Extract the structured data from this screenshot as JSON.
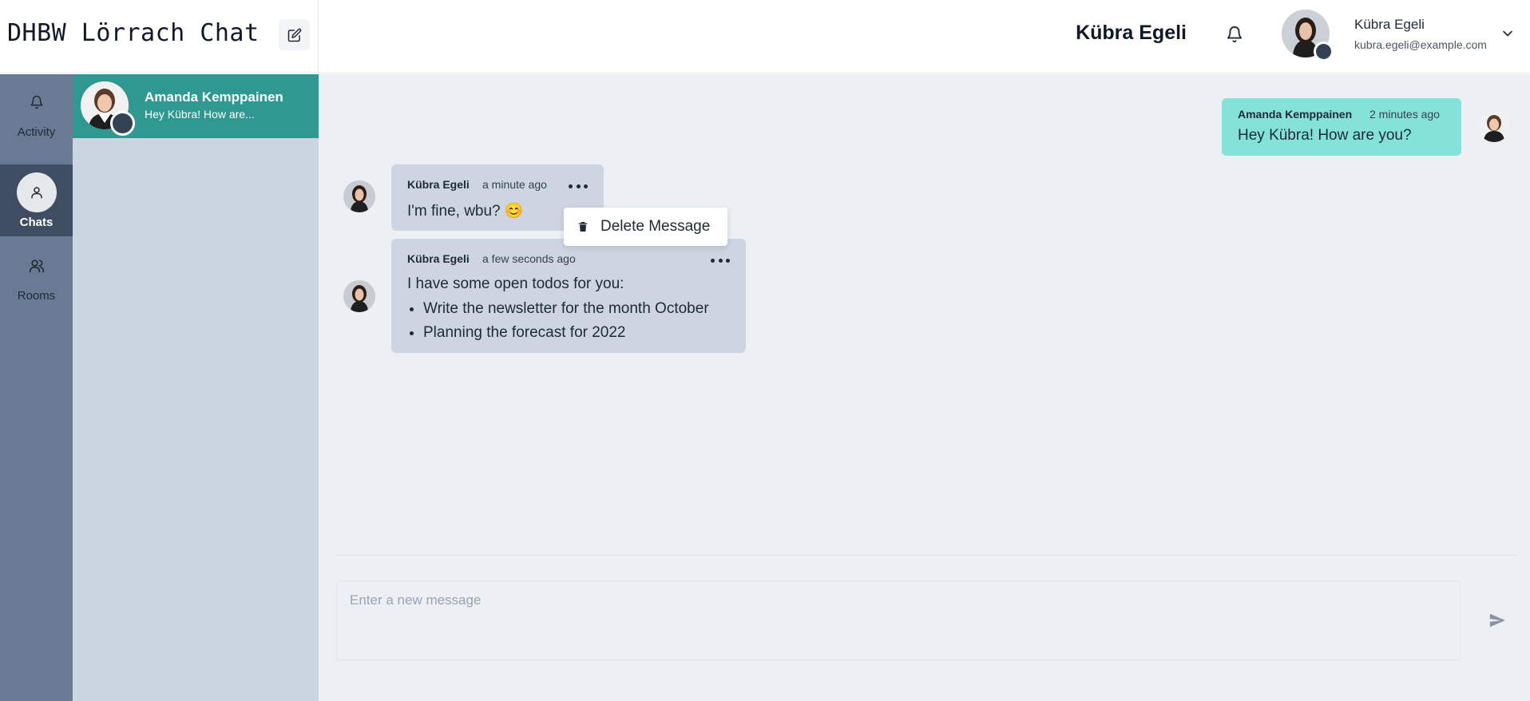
{
  "app": {
    "title": "DHBW Lörrach Chat"
  },
  "header": {
    "chat_name": "Kübra Egeli",
    "user": {
      "name": "Kübra Egeli",
      "email": "kubra.egeli@example.com"
    }
  },
  "nav": {
    "items": [
      {
        "label": "Activity",
        "icon": "bell-icon",
        "active": false
      },
      {
        "label": "Chats",
        "icon": "user-icon",
        "active": true
      },
      {
        "label": "Rooms",
        "icon": "users-icon",
        "active": false
      }
    ]
  },
  "chat_list": [
    {
      "name": "Amanda Kemppainen",
      "preview": "Hey Kübra! How are..."
    }
  ],
  "messages": [
    {
      "author": "Amanda Kemppainen",
      "time": "2 minutes ago",
      "text": "Hey Kübra! How are you?",
      "mine": true
    },
    {
      "author": "Kübra Egeli",
      "time": "a minute ago",
      "text": "I'm fine, wbu? 😊",
      "mine": false
    },
    {
      "author": "Kübra Egeli",
      "time": "a few seconds ago",
      "text": "I have some open todos for you:",
      "list": [
        "Write the newsletter for the month October",
        "Planning the forecast for 2022"
      ],
      "mine": false
    }
  ],
  "context_menu": {
    "label": "Delete Message"
  },
  "composer": {
    "placeholder": "Enter a new message"
  },
  "colors": {
    "accent": "#2f9890",
    "mine_bubble": "#84e3d9",
    "theirs_bubble": "#ccd5e0",
    "nav_bg": "#6b7a94"
  }
}
